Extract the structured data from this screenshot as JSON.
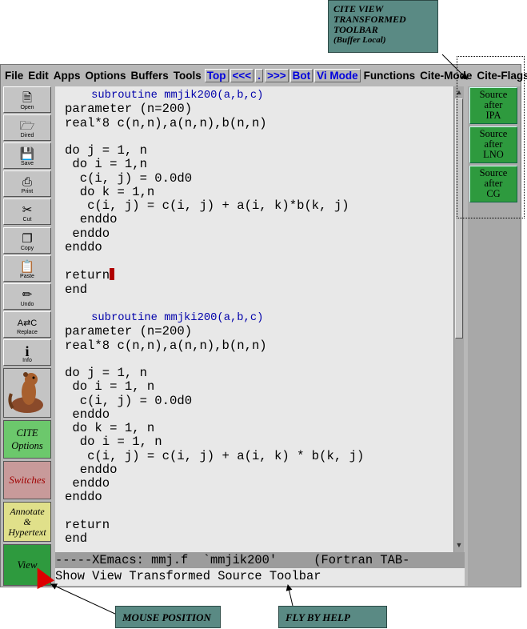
{
  "annotations": {
    "cite_view": {
      "line1": "CITE VIEW",
      "line2": "TRANSFORMED",
      "line3": "TOOLBAR",
      "line4": "(Buffer Local)"
    },
    "mouse_position": "MOUSE POSITION",
    "fly_by_help": "FLY BY HELP"
  },
  "menubar": {
    "items": [
      "File",
      "Edit",
      "Apps",
      "Options",
      "Buffers",
      "Tools"
    ],
    "nav": [
      "Top",
      "<<<",
      ".",
      ">>>",
      "Bot",
      "Vi Mode"
    ],
    "right_items": [
      "Functions",
      "Cite-Mode",
      "Cite-Flags"
    ]
  },
  "toolbar": {
    "buttons": [
      {
        "label": "Open",
        "icon": "document-icon"
      },
      {
        "label": "Dired",
        "icon": "folder-icon"
      },
      {
        "label": "Save",
        "icon": "floppy-icon"
      },
      {
        "label": "Print",
        "icon": "printer-icon"
      },
      {
        "label": "Cut",
        "icon": "scissors-icon"
      },
      {
        "label": "Copy",
        "icon": "copy-icon"
      },
      {
        "label": "Paste",
        "icon": "paste-icon"
      },
      {
        "label": "Undo",
        "icon": "eraser-icon"
      },
      {
        "label": "Replace",
        "icon": "replace-icon"
      },
      {
        "label": "Info",
        "icon": "info-icon"
      }
    ],
    "cite_options": {
      "line1": "CITE",
      "line2": "Options"
    },
    "switches": "Switches",
    "annotate": {
      "line1": "Annotate",
      "line2": "&",
      "line3": "Hypertext"
    },
    "view": "View"
  },
  "right_toolbar": {
    "buttons": [
      {
        "line1": "Source",
        "line2": "after",
        "line3": "IPA"
      },
      {
        "line1": "Source",
        "line2": "after",
        "line3": "LNO"
      },
      {
        "line1": "Source",
        "line2": "after",
        "line3": "CG"
      }
    ]
  },
  "code": {
    "lines": [
      "subroutine mmjik200(a,b,c)",
      "parameter (n=200)",
      "real*8 c(n,n),a(n,n),b(n,n)",
      "",
      "do j = 1, n",
      " do i = 1,n",
      "  c(i, j) = 0.0d0",
      "  do k = 1,n",
      "   c(i, j) = c(i, j) + a(i, k)*b(k, j)",
      "  enddo",
      " enddo",
      "enddo",
      "",
      "return",
      "end",
      "",
      "subroutine mmjki200(a,b,c)",
      "parameter (n=200)",
      "real*8 c(n,n),a(n,n),b(n,n)",
      "",
      "do j = 1, n",
      " do i = 1, n",
      "  c(i, j) = 0.0d0",
      " enddo",
      " do k = 1, n",
      "  do i = 1, n",
      "   c(i, j) = c(i, j) + a(i, k) * b(k, j)",
      "  enddo",
      " enddo",
      "enddo",
      "",
      "return",
      "end"
    ]
  },
  "modeline": "-----XEmacs: mmj.f  `mmjik200'     (Fortran TAB-",
  "minibuffer": "Show View Transformed Source Toolbar",
  "colors": {
    "callout": "#5a8a84",
    "source_button": "#2e9a3e",
    "cite_options": "#6cc86c",
    "switches": "#c89a9a",
    "annotate": "#e0e08a",
    "view": "#2e9a3e",
    "arrow_red": "#dd0000"
  }
}
